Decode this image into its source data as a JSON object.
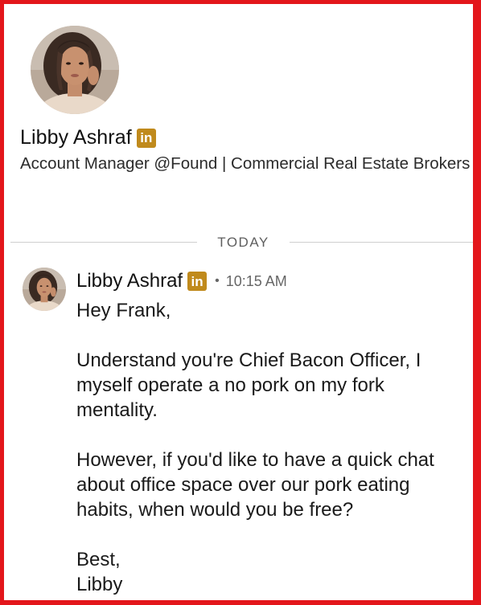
{
  "profile": {
    "name": "Libby Ashraf",
    "badge": "in",
    "headline": "Account Manager @Found | Commercial Real Estate Brokers"
  },
  "divider": {
    "label": "TODAY"
  },
  "message": {
    "sender": "Libby Ashraf",
    "badge": "in",
    "separator": "•",
    "time": "10:15 AM",
    "greeting": "Hey Frank,",
    "paragraph1": "Understand you're Chief Bacon Officer, I myself operate a no pork on my fork mentality.",
    "paragraph2": "However, if you'd like to have a quick chat about office space over our pork eating habits, when would you be free?",
    "closing": "Best,",
    "signoff": "Libby"
  },
  "colors": {
    "frame_border": "#e3161b",
    "badge": "#c08a1c",
    "divider": "#cfcfcf"
  }
}
